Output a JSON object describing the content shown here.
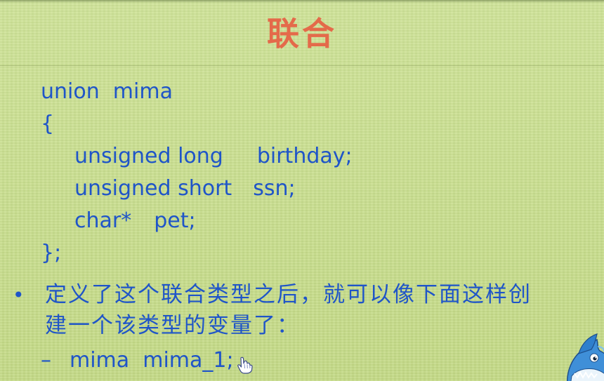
{
  "slide": {
    "title": "联合",
    "code_lines": [
      "union  mima",
      "{",
      "unsigned long",
      "birthday;",
      "unsigned short",
      "ssn;",
      "char*",
      "pet;",
      "};"
    ],
    "bullet_marker": "•",
    "bullet_text_line1": "定义了这个联合类型之后，就可以像下面这样创",
    "bullet_text_line2": "建一个该类型的变量了：",
    "sub_marker": "–",
    "sub_code": "mima  mima_1;"
  },
  "icons": {
    "cursor": "hand-pointer-icon",
    "mascot": "shark-mascot-icon"
  },
  "colors": {
    "background": "#c6dc8a",
    "title": "#e46a4a",
    "text": "#1f55c8"
  }
}
